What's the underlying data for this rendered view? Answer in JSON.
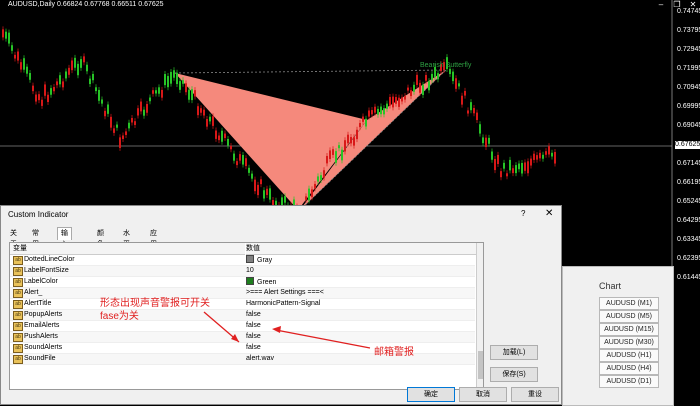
{
  "chart": {
    "ohlc_text": "AUDUSD,Daily  0.66824 0.67768 0.66511 0.67625",
    "pattern_label": "Bearish Butterfly",
    "current_price": "0.67625",
    "price_axis": [
      "0.74745",
      "0.73795",
      "0.72945",
      "0.71995",
      "0.70945",
      "0.69995",
      "0.69045",
      "0.68095",
      "0.67145",
      "0.66195",
      "0.65245",
      "0.64295",
      "0.63345",
      "0.62395",
      "0.61445"
    ],
    "bull_color": "#27c427",
    "bear_color": "#d81818",
    "pattern_fill": "#f5897c"
  },
  "right_panel": {
    "title": "Chart",
    "buttons": [
      "AUDUSD (M1)",
      "AUDUSD (M5)",
      "AUDUSD (M15)",
      "AUDUSD (M30)",
      "AUDUSD (H1)",
      "AUDUSD (H4)",
      "AUDUSD (D1)"
    ]
  },
  "dialog": {
    "title": "Custom Indicator",
    "help": "?",
    "close": "✕",
    "tabs": [
      "关于",
      "常用",
      "输入参数",
      "颜色",
      "水平位",
      "应用范围"
    ],
    "headers": {
      "variable": "变量",
      "value": "数值"
    },
    "rows": [
      {
        "name": "DottedLineColor",
        "value": "Gray",
        "swatch": "#808080"
      },
      {
        "name": "LabelFontSize",
        "value": "10"
      },
      {
        "name": "LabelColor",
        "value": "Green",
        "swatch": "#1e7e1e"
      },
      {
        "name": "Alert_",
        "value": ">=== Alert Settings ===<"
      },
      {
        "name": "AlertTitle",
        "value": "HarmonicPattern-Signal"
      },
      {
        "name": "PopupAlerts",
        "value": "false"
      },
      {
        "name": "EmailAlerts",
        "value": "false"
      },
      {
        "name": "PushAlerts",
        "value": "false"
      },
      {
        "name": "SoundAlerts",
        "value": "false"
      },
      {
        "name": "SoundFile",
        "value": "alert.wav"
      }
    ],
    "load_button": "加载(L)",
    "save_button": "保存(S)",
    "ok_button": "确定",
    "cancel_button": "取消",
    "reset_button": "重设"
  },
  "annotations": {
    "line1": "形态出现声音警报可开关",
    "line2": "fase为关",
    "email": "邮箱警报"
  }
}
